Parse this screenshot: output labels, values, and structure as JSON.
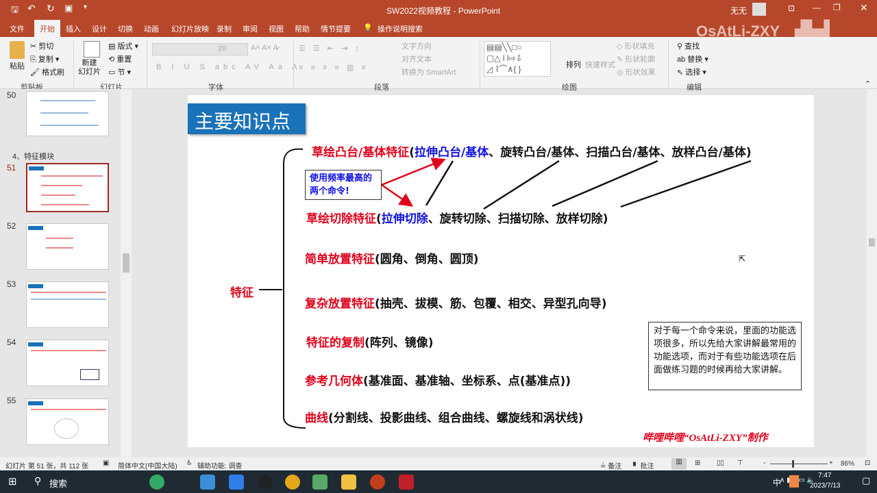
{
  "window": {
    "title": "SW2022视频教程 - PowerPoint",
    "user": "无无",
    "watermark": "OsAtLi-ZXY"
  },
  "tabs": [
    "文件",
    "开始",
    "插入",
    "设计",
    "切换",
    "动画",
    "幻灯片放映",
    "录制",
    "审阅",
    "视图",
    "帮助",
    "情节提要"
  ],
  "tell_me": "操作说明搜索",
  "ribbon": {
    "clipboard": {
      "paste": "粘贴",
      "cut": "剪切",
      "copy": "复制",
      "format_painter": "格式刷",
      "label": "剪贴板"
    },
    "slides": {
      "new_slide": "新建\n幻灯片",
      "layout": "版式",
      "reset": "重置",
      "section": "节",
      "label": "幻灯片"
    },
    "font": {
      "size": "20",
      "label": "字体"
    },
    "paragraph": {
      "text_direction": "文字方向",
      "align_text": "对齐文本",
      "smartart": "转换为 SmartArt",
      "label": "段落"
    },
    "drawing": {
      "arrange": "排列",
      "quick_styles": "快速样式",
      "shape_fill": "形状填充",
      "shape_outline": "形状轮廓",
      "shape_effects": "形状效果",
      "label": "绘图"
    },
    "editing": {
      "find": "查找",
      "replace": "替换",
      "select": "选择",
      "label": "编辑"
    }
  },
  "thumbnails": {
    "section": "4、特征模块",
    "slides": [
      "50",
      "51",
      "52",
      "53",
      "54",
      "55"
    ],
    "selected": "51"
  },
  "slide": {
    "title": "主要知识点",
    "root": "特征",
    "callout": "使用频率最高的两个命令!",
    "rows": [
      {
        "head": "草绘凸台/基体特征",
        "open": "(",
        "blue": "拉伸凸台/基体",
        "rest": "、旋转凸台/基体、扫描凸台/基体、放样凸台/基体)"
      },
      {
        "head": "草绘切除特征",
        "open": "(",
        "blue": "拉伸切除",
        "rest": "、旋转切除、扫描切除、放样切除)"
      },
      {
        "head": "简单放置特征",
        "rest": "(圆角、倒角、圆顶)"
      },
      {
        "head": "复杂放置特征",
        "rest": "(抽壳、拔模、筋、包覆、相交、异型孔向导)"
      },
      {
        "head": "特征的复制",
        "rest": "(阵列、镜像)"
      },
      {
        "head": "参考几何体",
        "rest": "(基准面、基准轴、坐标系、点(基准点))"
      },
      {
        "head": "曲线",
        "rest": "(分割线、投影曲线、组合曲线、螺旋线和涡状线)"
      }
    ],
    "note": "对于每一个命令来说，里面的功能选项很多，所以先给大家讲解最常用的功能选项，而对于有些功能选项在后面做练习题的时候再给大家讲解。",
    "signature": "哔哩哔哩“OsAtLi-ZXY”制作",
    "colors": {
      "red": "#e0001a",
      "blue": "#1010e0",
      "title_bg": "#1a72b8"
    }
  },
  "status": {
    "slide_info": "幻灯片 第 51 张，共 112 张",
    "language": "简体中文(中国大陆)",
    "accessibility": "辅助功能: 调查",
    "notes": "备注",
    "comments": "批注",
    "zoom": "86%"
  },
  "taskbar": {
    "search": "搜索",
    "time": "7:47",
    "date": "2023/7/13",
    "ime": "中"
  }
}
